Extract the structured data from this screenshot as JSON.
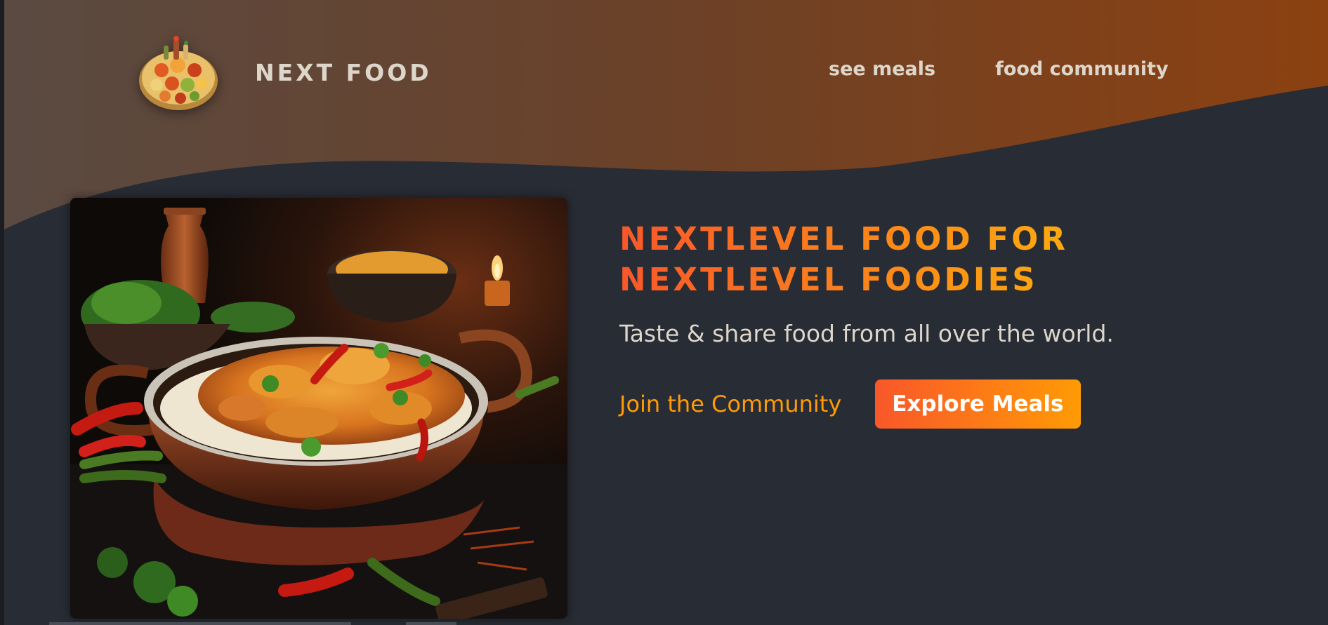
{
  "header": {
    "logo_text": "NEXT FOOD",
    "logo_alt": "A plate with food on it"
  },
  "nav": {
    "items": [
      {
        "label": "see meals"
      },
      {
        "label": "food community"
      }
    ]
  },
  "hero": {
    "title_line_1": "NEXTLEVEL FOOD FOR",
    "title_line_2": "NEXTLEVEL FOODIES",
    "subtitle": "Taste & share food from all over the world.",
    "community_link": "Join the Community",
    "explore_button": "Explore Meals",
    "image_alt": "Chicken curry with rice in a copper bowl"
  },
  "colors": {
    "background": "#282c34",
    "header_gradient_start": "#5a4a42",
    "header_gradient_end": "#8c4111",
    "accent_orange": "#f9572a",
    "accent_yellow": "#ffc905",
    "link_color": "#ff9b05",
    "text_light": "#ddd6cb"
  }
}
